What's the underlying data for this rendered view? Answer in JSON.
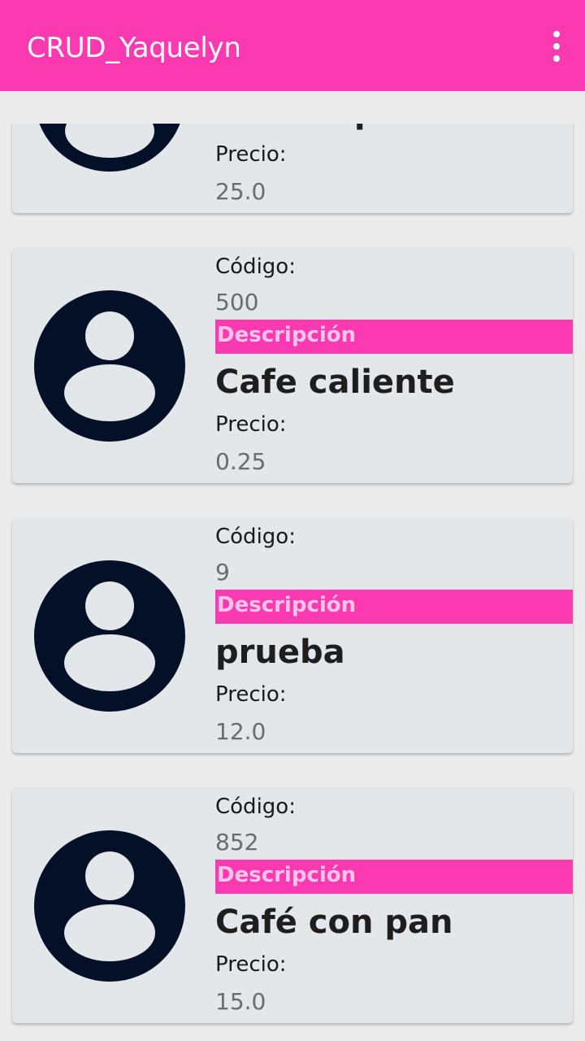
{
  "app_bar": {
    "title": "CRUD_Yaquelyn",
    "menu_icon": "overflow-menu-icon",
    "color": "#fb39b0"
  },
  "labels": {
    "codigo": "Código:",
    "descripcion": "Descripción",
    "precio": "Precio:"
  },
  "products": [
    {
      "codigo": "",
      "descripcion": "camisa polo",
      "precio": "25.0"
    },
    {
      "codigo": "500",
      "descripcion": "Cafe caliente",
      "precio": "0.25"
    },
    {
      "codigo": "9",
      "descripcion": "prueba",
      "precio": "12.0"
    },
    {
      "codigo": "852",
      "descripcion": "Café con pan",
      "precio": "15.0"
    }
  ],
  "avatar_icon": "account-circle-icon"
}
